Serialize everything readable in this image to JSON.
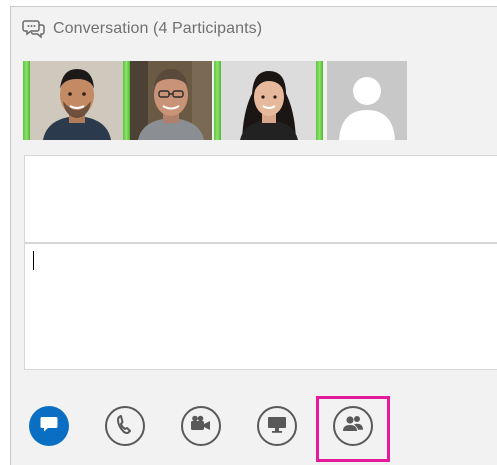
{
  "window": {
    "title": "Conversation (4 Participants)"
  },
  "icons": {
    "title": "chat-bubbles-icon",
    "im": "chat-bubble-icon",
    "call": "phone-icon",
    "video": "video-camera-icon",
    "present": "monitor-icon",
    "people": "people-icon"
  },
  "participants": [
    {
      "speaking": true
    },
    {
      "speaking": false
    },
    {
      "speaking": true
    },
    {
      "speaking": false,
      "placeholder": true
    }
  ],
  "compose": {
    "value": ""
  },
  "colors": {
    "accent": "#0a6fc2",
    "speaking": "#5cc43f",
    "highlight": "#e5199b",
    "icon": "#595959"
  },
  "toolbar": {
    "active": "im",
    "highlighted": "people"
  }
}
